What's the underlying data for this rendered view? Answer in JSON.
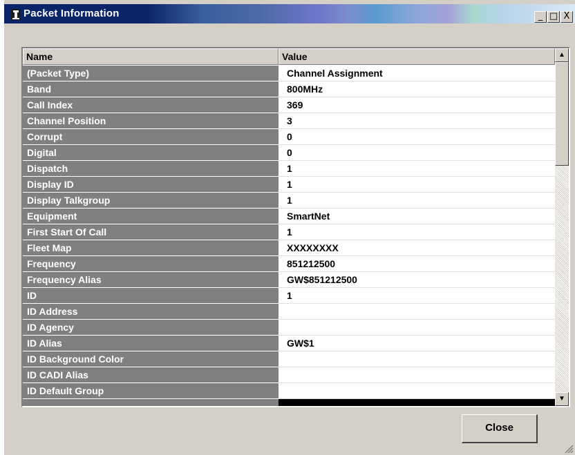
{
  "window": {
    "title": "Packet Information",
    "minimize_glyph": "_",
    "maximize_glyph": "□",
    "close_glyph": "X"
  },
  "grid": {
    "columns": [
      "Name",
      "Value"
    ],
    "rows": [
      {
        "name": "(Packet Type)",
        "value": "Channel Assignment"
      },
      {
        "name": "Band",
        "value": "800MHz"
      },
      {
        "name": "Call Index",
        "value": "369"
      },
      {
        "name": "Channel Position",
        "value": "3"
      },
      {
        "name": "Corrupt",
        "value": "0"
      },
      {
        "name": "Digital",
        "value": "0"
      },
      {
        "name": "Dispatch",
        "value": "1"
      },
      {
        "name": "Display ID",
        "value": "1"
      },
      {
        "name": "Display Talkgroup",
        "value": "1"
      },
      {
        "name": "Equipment",
        "value": "SmartNet"
      },
      {
        "name": "First Start Of Call",
        "value": "1"
      },
      {
        "name": "Fleet Map",
        "value": "XXXXXXXX"
      },
      {
        "name": "Frequency",
        "value": "851212500"
      },
      {
        "name": "Frequency Alias",
        "value": "GW$851212500"
      },
      {
        "name": "ID",
        "value": "1"
      },
      {
        "name": "ID Address",
        "value": ""
      },
      {
        "name": "ID Agency",
        "value": ""
      },
      {
        "name": "ID Alias",
        "value": "GW$1"
      },
      {
        "name": "ID Background Color",
        "value": ""
      },
      {
        "name": "ID CADI Alias",
        "value": ""
      },
      {
        "name": "ID Default Group",
        "value": ""
      }
    ],
    "scroll_up_glyph": "▲",
    "scroll_down_glyph": "▼"
  },
  "buttons": {
    "close_label": "Close"
  },
  "icons": {
    "app": "tower-icon",
    "resize": "resize-grip-icon"
  }
}
